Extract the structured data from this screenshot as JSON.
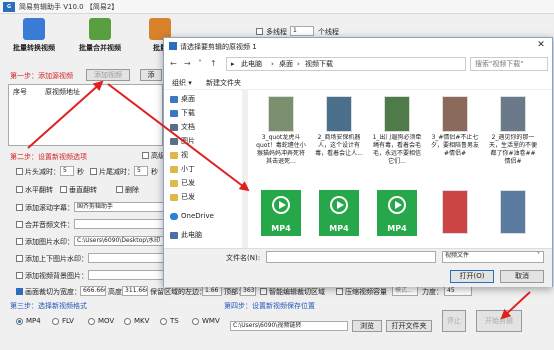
{
  "app": {
    "title": "简易剪辑助手 V10.0  【简易2】",
    "toolbar": [
      {
        "label": "批量转换视频",
        "color": "#3a7bd5"
      },
      {
        "label": "批量合并视频",
        "color": "#5a9f3f"
      },
      {
        "label": "批量",
        "color": "#d9822b"
      }
    ],
    "multi_thread_label": "多线程",
    "thread_count": "1",
    "thread_unit": "个线程",
    "step1": "第一步：添加源视频",
    "add_video_btn": "添加视频",
    "add_btn2": "添",
    "table_headers": [
      "序号",
      "原视频地址"
    ],
    "step2": "第二步：设置新视频选项",
    "hd_output": "高级自",
    "head_cut": "片头减时：",
    "head_val": "5",
    "sec1": "秒",
    "tail_cut": "片尾减时：",
    "tail_val": "5",
    "sec2": "秒",
    "flip_h": "水平翻转",
    "flip_v": "垂直翻转",
    "remove_orig": "删除",
    "add_text_wm": "添加滚动字幕：",
    "text_wm_val": "国齐剪辑助手",
    "merge_audio": "合并音频文件：",
    "add_pic_wm": "添加图片水印：",
    "pic_wm_val": "C:\\Users\\6090\\Desktop\\水印",
    "add_edge": "添加上下图片水印：",
    "add_bg": "添加视频背景图片：",
    "crop_label": "画面裁切为宽度：",
    "crop_w": "666.666",
    "height_label": "高度：",
    "crop_h": "311.666",
    "keep_label": "保留区域的左边：",
    "keep_val": "1.66",
    "top_label": "顶部：",
    "top_val": "363",
    "smart_blur": "智能编辑裁切区域",
    "compress": "压缩视频容量",
    "mode_label": "模式...",
    "force_label": "力度：",
    "force_val": "45",
    "step3": "第三步：选择新视频格式",
    "formats": [
      "MP4",
      "FLV",
      "MOV",
      "MKV",
      "TS",
      "WMV"
    ],
    "step4": "第四步：设置新视频保存位置",
    "save_path": "C:\\Users\\6090\\视频链转",
    "browse_btn": "浏览",
    "open_folder_btn": "打开文件夹",
    "stop_btn": "停止",
    "start_btn": "开始剪辑"
  },
  "dialog": {
    "title": "请选择要剪辑的原视频 1",
    "breadcrumb": [
      "此电脑",
      "桌面",
      "视频下载"
    ],
    "search_placeholder": "搜索\"视频下载\"",
    "organize": "组织 ▾",
    "new_folder": "新建文件夹",
    "sidebar": [
      {
        "label": "桌面",
        "color": "#3b78c4"
      },
      {
        "label": "下载",
        "color": "#3b78c4"
      },
      {
        "label": "文档",
        "color": "#5b6e85"
      },
      {
        "label": "图片",
        "color": "#5b6e85"
      },
      {
        "label": "视",
        "color": "#e0b84a"
      },
      {
        "label": "小丁",
        "color": "#e0b84a"
      },
      {
        "label": "已发",
        "color": "#e0b84a"
      },
      {
        "label": "已发",
        "color": "#e0b84a"
      },
      {
        "label": "OneDrive",
        "color": "#2f7fd8"
      },
      {
        "label": "此电脑",
        "color": "#4a6fa5"
      }
    ],
    "files": [
      {
        "name": "3_quot龙虎斗quot！毒蛇缠住小猴猫妈妈冲弄死将其击退死...",
        "thumb": "#7b8f6e"
      },
      {
        "name": "2_商场安保机器人，这个设计有毒，看着会让人...",
        "thumb": "#4a6f8a"
      },
      {
        "name": "1_出门遛狗必须牵绳有毒，看着会毛毛，永远不要相信它们...",
        "thumb": "#4f7a4a"
      },
      {
        "name": "3_#情侣#不止七夕，要相陪鲁男友#情侣#",
        "thumb": "#8a6a5a"
      },
      {
        "name": "2_遇见你的那一天，生活里的不便都了你#油卷##情侣#",
        "thumb": "#6b7a8a"
      },
      {
        "name": "MP4",
        "thumb": "mp4"
      },
      {
        "name": "MP4",
        "thumb": "mp4"
      },
      {
        "name": "MP4",
        "thumb": "mp4"
      },
      {
        "name": "",
        "thumb": "#c44"
      },
      {
        "name": "",
        "thumb": "#5a7aa0"
      }
    ],
    "filename_label": "文件名(N):",
    "filetype": "视频文件",
    "open_btn": "打开(O)",
    "cancel_btn": "取消"
  }
}
